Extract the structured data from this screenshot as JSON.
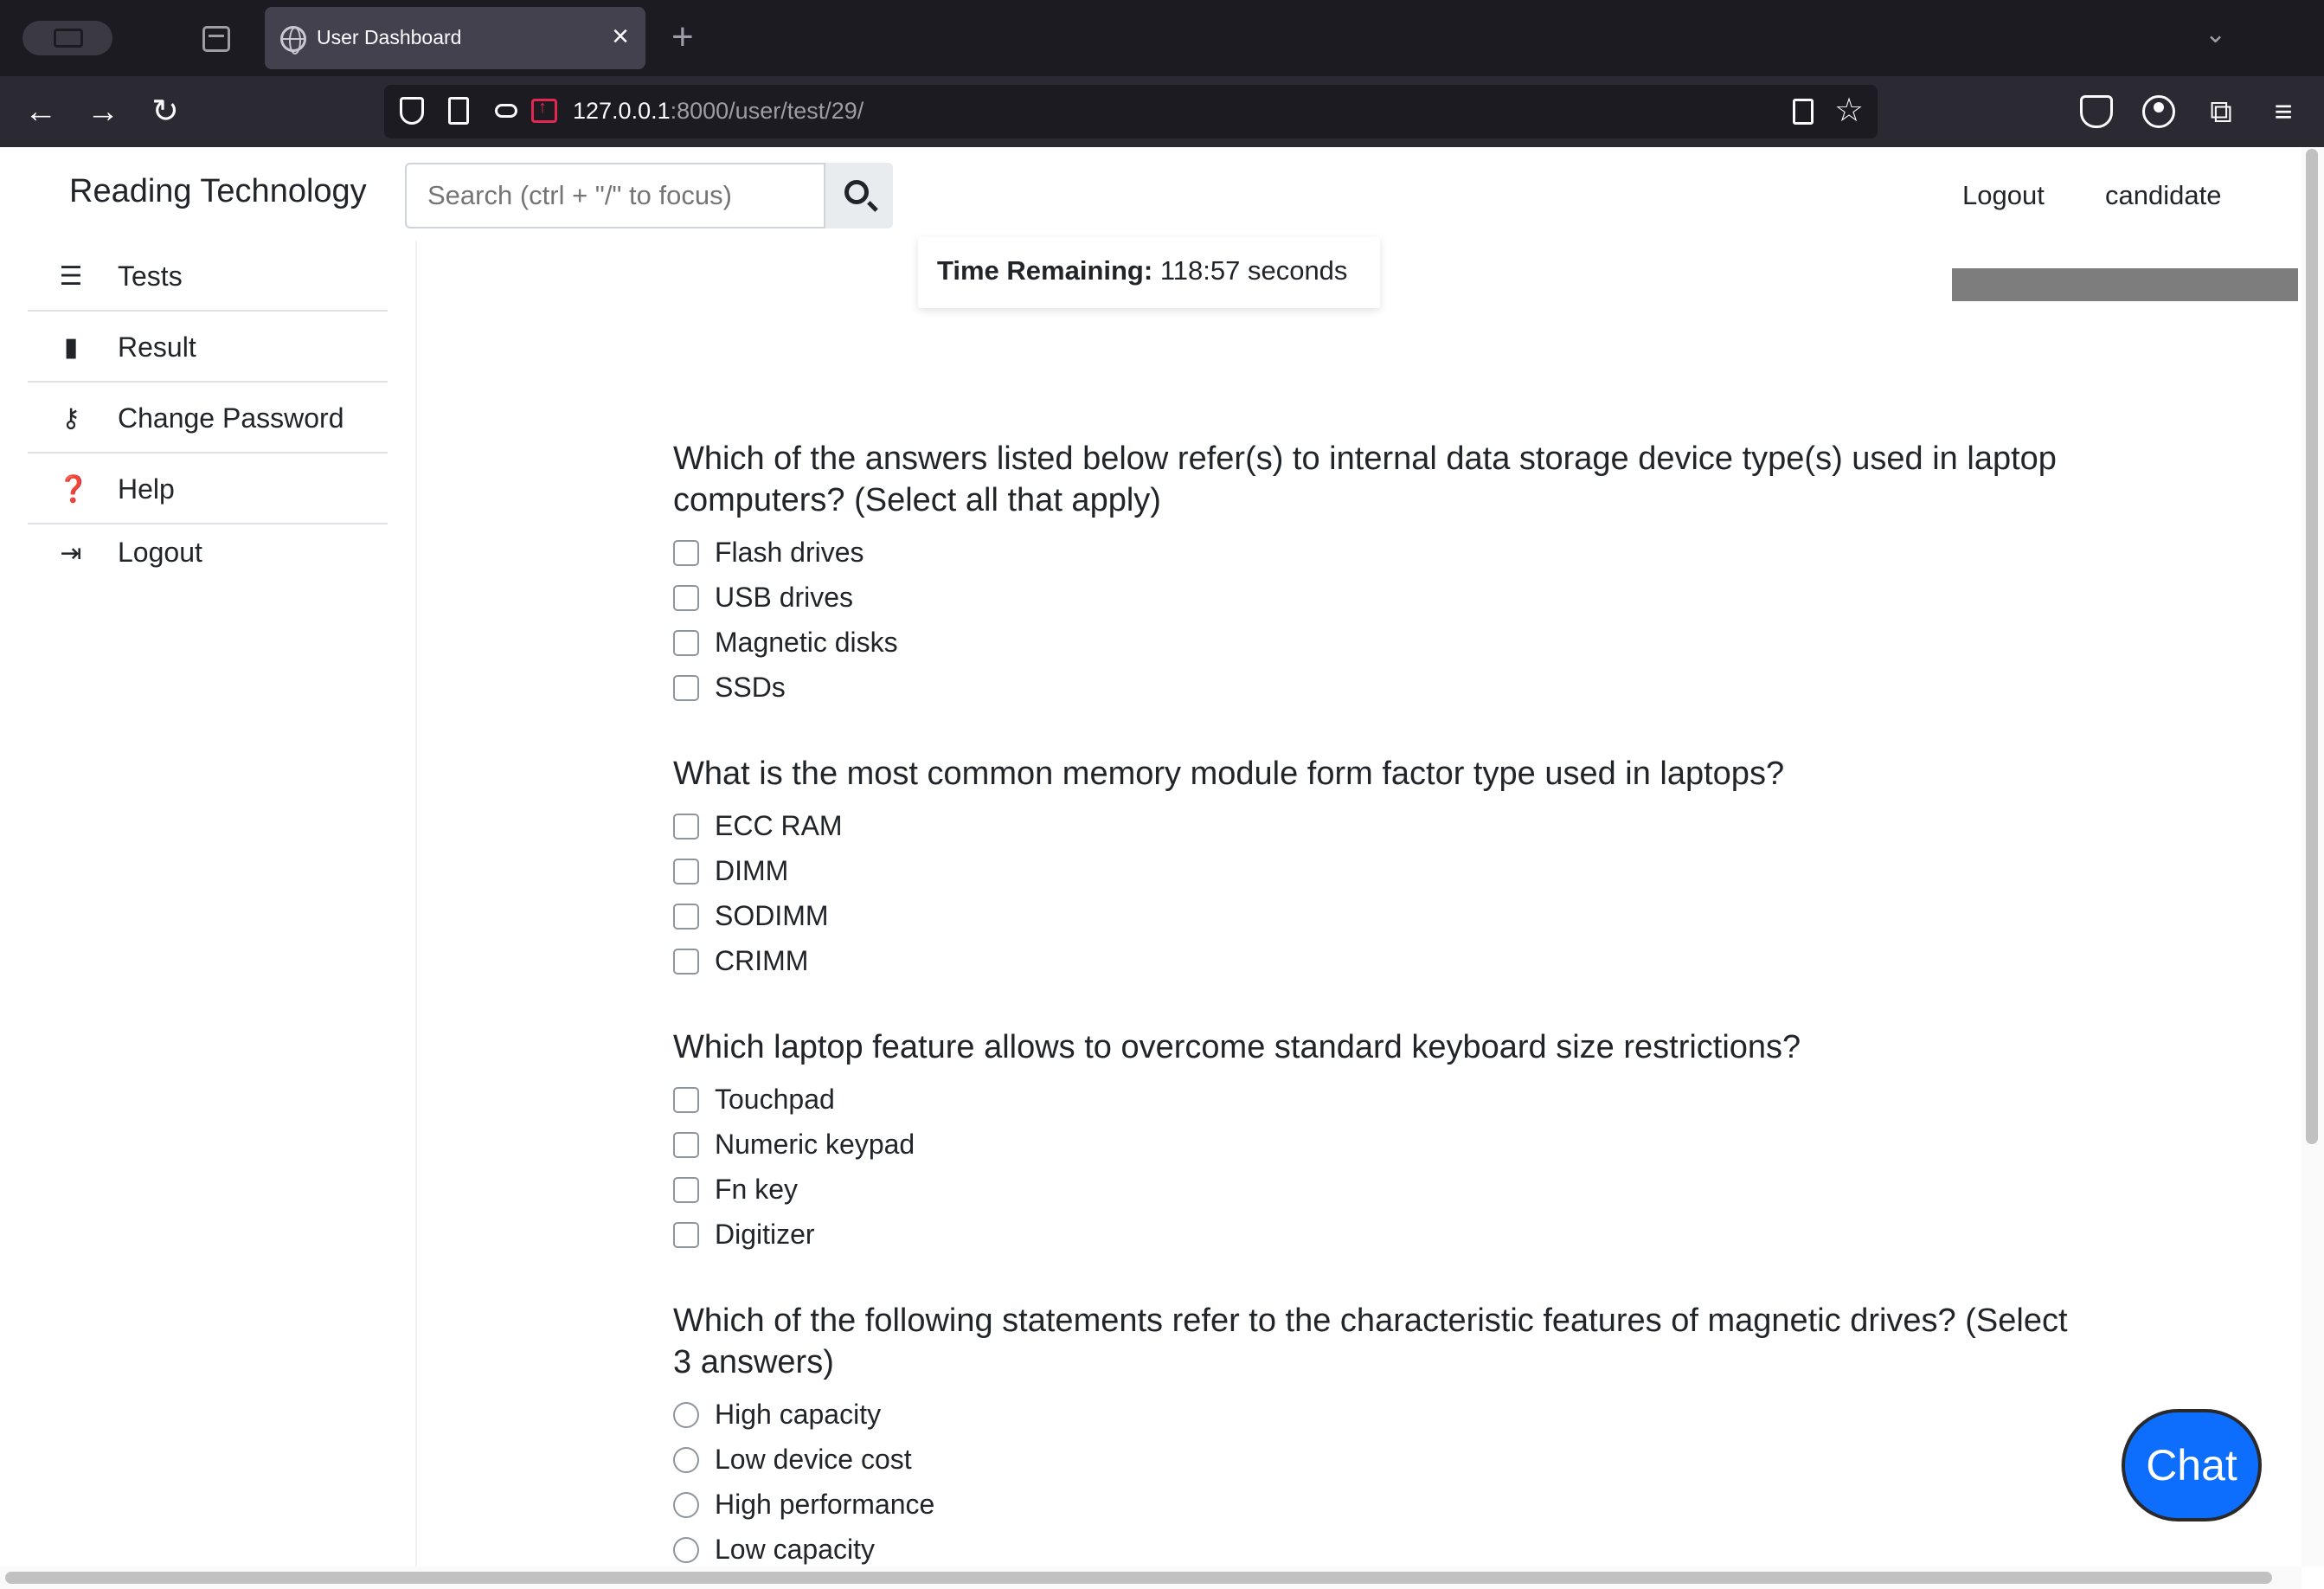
{
  "browser": {
    "tab_title": "User Dashboard",
    "url_host": "127.0.0.1",
    "url_path": ":8000/user/test/29/"
  },
  "header": {
    "brand": "Reading Technology",
    "search_placeholder": "Search (ctrl + \"/\" to focus)",
    "logout": "Logout",
    "username": "candidate"
  },
  "sidebar": {
    "items": [
      {
        "label": "Tests",
        "icon": "list-check-icon"
      },
      {
        "label": "Result",
        "icon": "clipboard-icon"
      },
      {
        "label": "Change Password",
        "icon": "key-icon"
      },
      {
        "label": "Help",
        "icon": "question-circle-icon"
      },
      {
        "label": "Logout",
        "icon": "sign-out-icon"
      }
    ]
  },
  "timer": {
    "label": "Time Remaining:",
    "value": "118:57 seconds"
  },
  "progress": {
    "fraction": 1.0,
    "color": "#7d7d7d"
  },
  "questions": [
    {
      "text": "Which of the answers listed below refer(s) to internal data storage device type(s) used in laptop computers? (Select all that apply)",
      "options": [
        "Flash drives",
        "USB drives",
        "Magnetic disks",
        "SSDs"
      ]
    },
    {
      "text": "What is the most common memory module form factor type used in laptops?",
      "options": [
        "ECC RAM",
        "DIMM",
        "SODIMM",
        "CRIMM"
      ]
    },
    {
      "text": "Which laptop feature allows to overcome standard keyboard size restrictions?",
      "options": [
        "Touchpad",
        "Numeric keypad",
        "Fn key",
        "Digitizer"
      ]
    },
    {
      "text": "Which of the following statements refer to the characteristic features of magnetic drives? (Select 3 answers)",
      "options": [
        "High capacity",
        "Low device cost",
        "High performance",
        "Low capacity"
      ]
    }
  ],
  "chat_label": "Chat",
  "colors": {
    "accent": "#0d6efd",
    "chrome": "#1c1b22"
  }
}
